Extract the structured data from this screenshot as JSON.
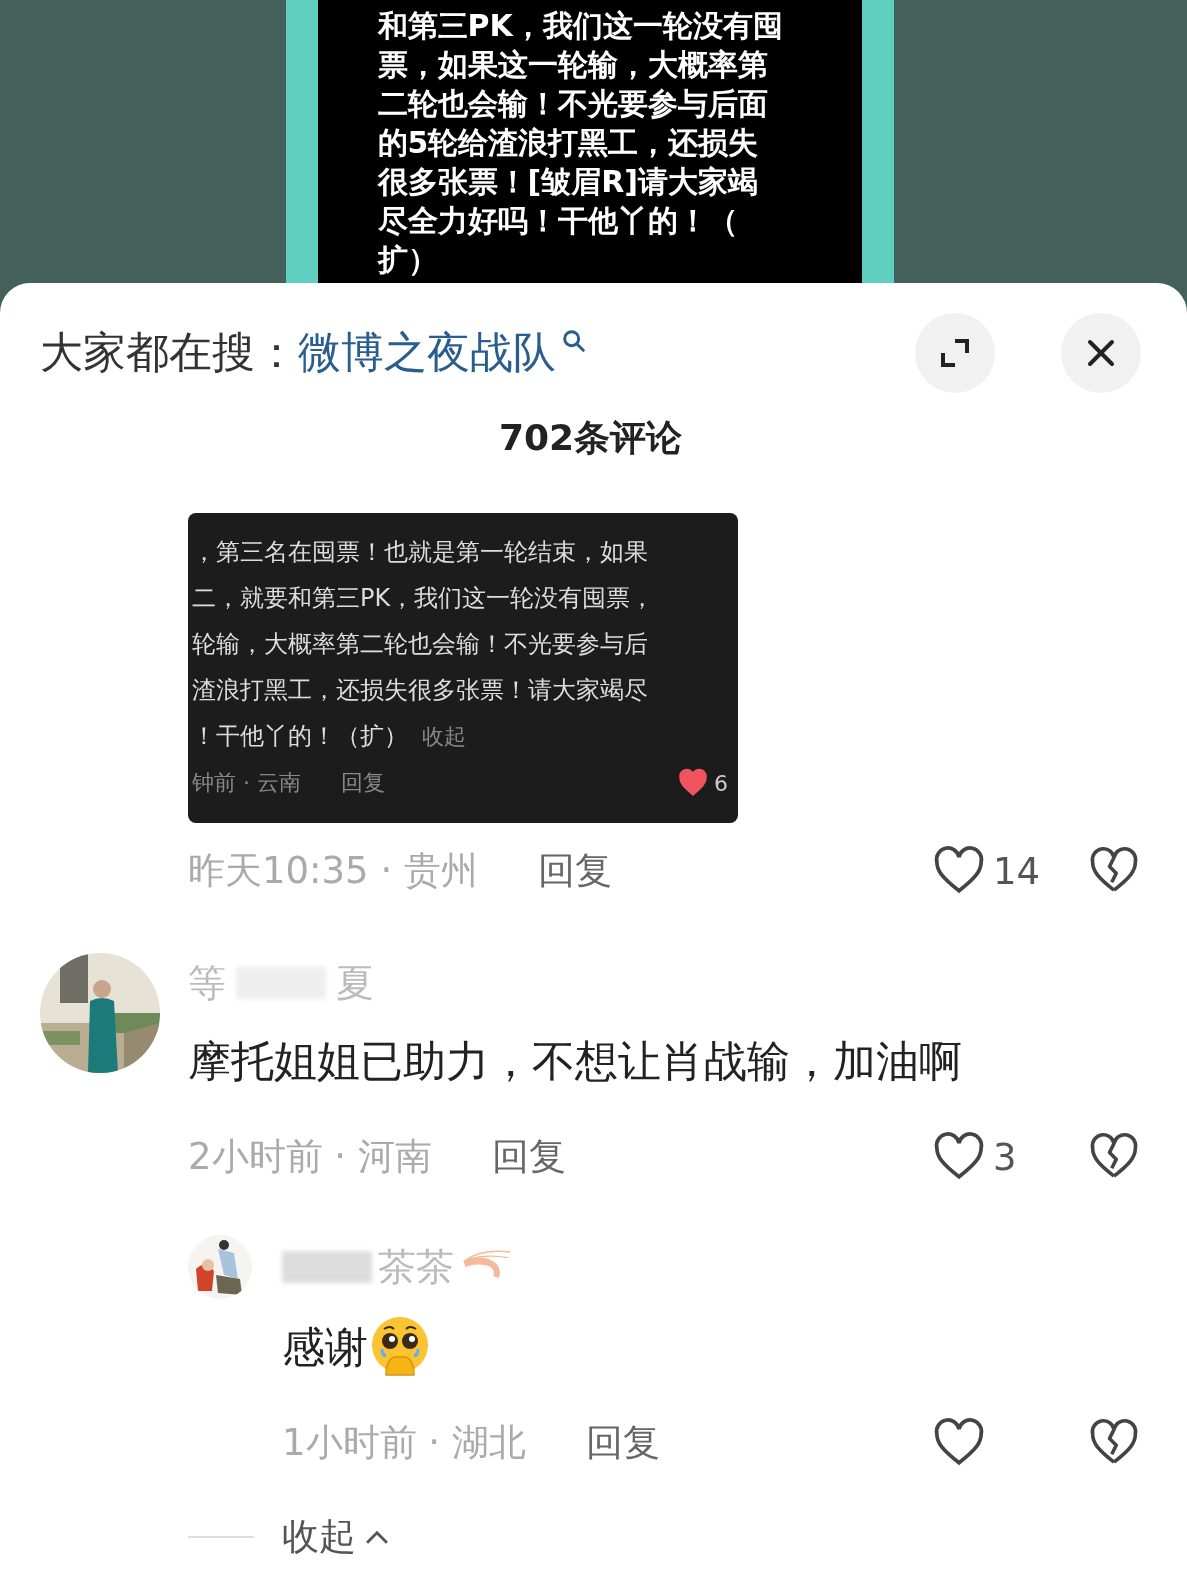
{
  "background_post": {
    "lines": [
      "和第三PK，我们这一轮没有囤",
      "票，如果这一轮输，大概率第",
      "二轮也会输！不光要参与后面",
      "的5轮给渣浪打黑工，还损失",
      "很多张票！[皱眉R]请大家竭",
      "尽全力好吗！干他丫的！（",
      "扩）"
    ]
  },
  "search_bar": {
    "label": "大家都在搜：",
    "query": "微博之夜战队"
  },
  "comments_count": "702条评论",
  "comments": [
    {
      "screenshot": {
        "lines": [
          "，第三名在囤票！也就是第一轮结束，如果",
          "二，就要和第三PK，我们这一轮没有囤票，",
          "轮输，大概率第二轮也会输！不光要参与后",
          "渣浪打黑工，还损失很多张票！请大家竭尽",
          "！干他丫的！（扩）"
        ],
        "collapse": "收起",
        "meta": "钟前 · 云南",
        "reply": "回复",
        "likes": "6",
        "liked": true
      },
      "time_location": "昨天10:35 · 贵州",
      "reply": "回复",
      "likes": "14",
      "liked": false
    },
    {
      "kind": "text",
      "name_parts": [
        {
          "text": "等",
          "redacted_before": false
        },
        {
          "text": "夏",
          "redacted_before": true
        }
      ],
      "text": "摩托姐姐已助力，不想让肖战输，加油啊",
      "time_location": "2小时前 · 河南",
      "reply": "回复",
      "likes": "3",
      "liked": false,
      "replies": [
        {
          "name_parts": [
            {
              "text": "茶茶",
              "redacted_before": true
            }
          ],
          "text": "感谢",
          "time_location": "1小时前 · 湖北",
          "reply": "回复",
          "liked": false
        }
      ]
    }
  ],
  "collapse": "收起"
}
